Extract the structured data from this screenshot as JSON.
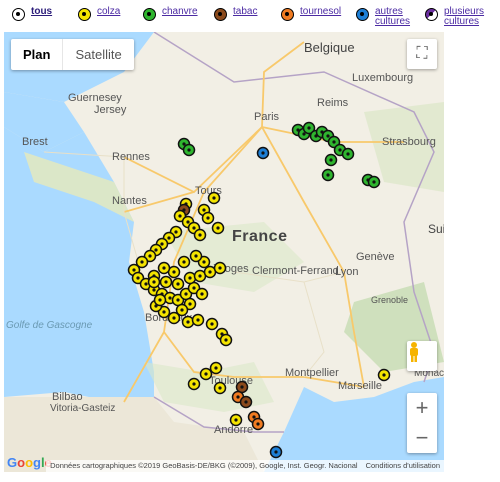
{
  "legend": [
    {
      "label": "tous",
      "color": "#ffffff",
      "bold": true
    },
    {
      "label": "colza",
      "color": "#f4e400"
    },
    {
      "label": "chanvre",
      "color": "#2fb52f"
    },
    {
      "label": "tabac",
      "color": "#8b4a1c"
    },
    {
      "label": "tournesol",
      "color": "#f07b21"
    },
    {
      "label": "autres cultures",
      "color": "#1d7fd6"
    },
    {
      "label": "plusieurs cultures",
      "color": "#6b2fa0"
    }
  ],
  "map": {
    "type_plan": "Plan",
    "type_satellite": "Satellite",
    "zoom_in": "+",
    "zoom_out": "−",
    "fullscreen": "⛶",
    "google": "Google",
    "attribution": "Données cartographiques ©2019 GeoBasis-DE/BKG (©2009), Google, Inst. Geogr. Nacional",
    "terms": "Conditions d'utilisation"
  },
  "places": {
    "belgique": "Belgique",
    "luxembourg": "Luxembourg",
    "guernesey": "Guernesey",
    "jersey": "Jersey",
    "brest": "Brest",
    "rennes": "Rennes",
    "nantes": "Nantes",
    "tours": "Tours",
    "paris": "Paris",
    "reims": "Reims",
    "strasbourg": "Strasbourg",
    "france": "France",
    "limoges": "Limoges",
    "clermont": "Clermont-Ferrand",
    "lyon": "Lyon",
    "geneve": "Genève",
    "grenoble": "Grenoble",
    "bordeaux": "Bordeaux",
    "golfe": "Golfe de Gascogne",
    "toulouse": "Toulouse",
    "montpellier": "Montpellier",
    "marseille": "Marseille",
    "monaco": "Monaco",
    "bilbao": "Bilbao",
    "vitoria": "Vitoria-Gasteiz",
    "andorre": "Andorre",
    "sui": "Sui"
  }
}
